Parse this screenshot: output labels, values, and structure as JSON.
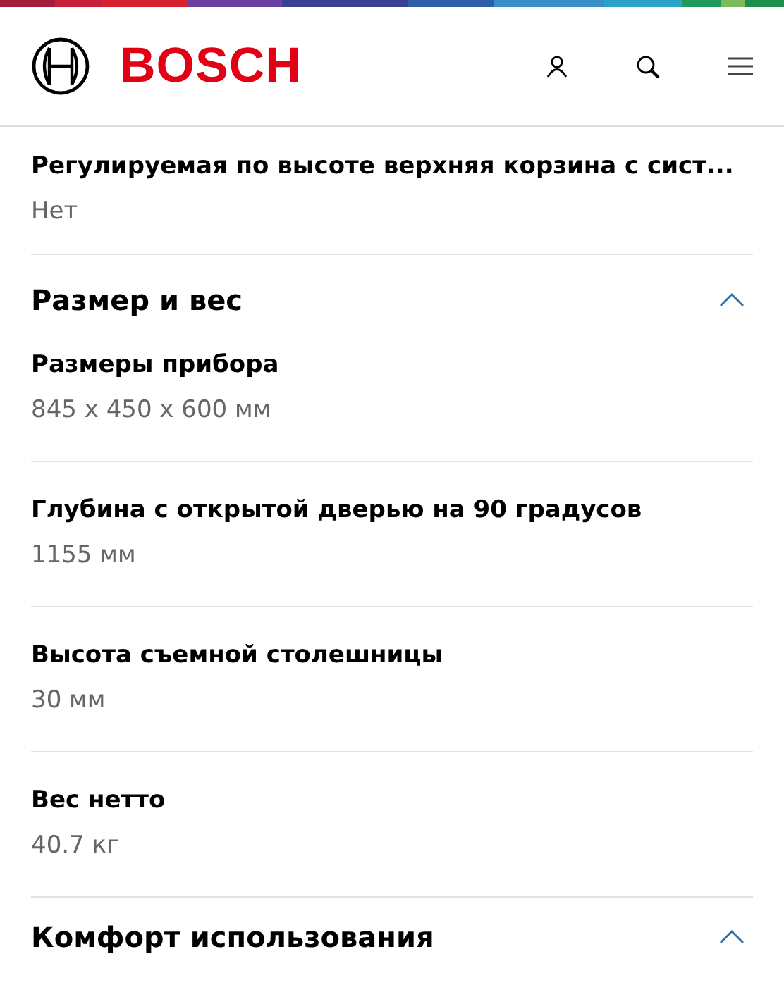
{
  "header": {
    "logo_text": "BOSCH"
  },
  "leading_items": [
    {
      "label": "Регулируемая по высоте верхняя корзина с сист...",
      "value": "Нет"
    }
  ],
  "sections": [
    {
      "title": "Размер и вес",
      "expanded": true,
      "items": [
        {
          "label": "Размеры прибора",
          "value": "845 x 450 x 600 мм"
        },
        {
          "label": "Глубина с открытой дверью на 90 градусов",
          "value": "1155 мм"
        },
        {
          "label": "Высота съемной столешницы",
          "value": "30 мм"
        },
        {
          "label": "Вес нетто",
          "value": "40.7 кг"
        }
      ]
    },
    {
      "title": "Комфорт использования",
      "expanded": true
    }
  ]
}
